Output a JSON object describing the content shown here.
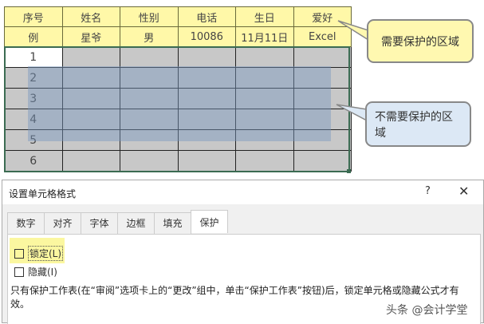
{
  "sheet": {
    "headers": [
      "序号",
      "姓名",
      "性别",
      "电话",
      "生日",
      "爱好"
    ],
    "example": [
      "例",
      "星爷",
      "男",
      "10086",
      "11月11日",
      "Excel"
    ],
    "row_numbers": [
      "1",
      "2",
      "3",
      "4",
      "5",
      "6"
    ]
  },
  "callouts": {
    "protected": "需要保护的区域",
    "unprotected": "不需要保护的区域"
  },
  "dialog": {
    "title": "设置单元格格式",
    "help": "?",
    "close": "✕",
    "tabs": [
      "数字",
      "对齐",
      "字体",
      "边框",
      "填充",
      "保护"
    ],
    "active_tab": "保护",
    "locked_label": "锁定(L)",
    "locked_checked": false,
    "hidden_label": "隐藏(I)",
    "hidden_checked": false,
    "note": "只有保护工作表(在“审阅”选项卡上的“更改”组中，单击“保护工作表”按钮)后，锁定单元格或隐藏公式才有效。"
  },
  "watermark": "头条 @会计学堂"
}
